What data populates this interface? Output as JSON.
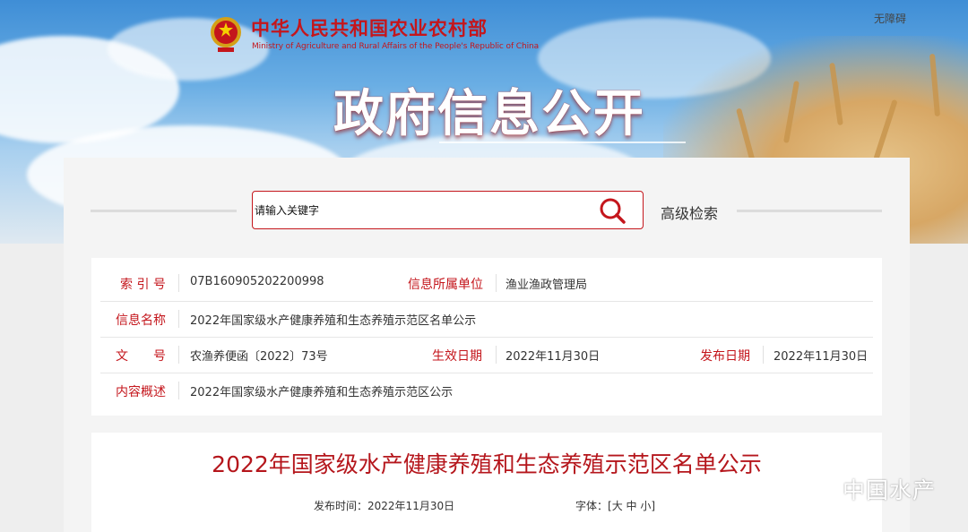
{
  "header": {
    "brand_cn": "中华人民共和国农业农村部",
    "brand_en": "Ministry of Agriculture and Rural Affairs of the People's Republic of China",
    "accessibility_link": "无障碍",
    "banner_title": "政府信息公开"
  },
  "search": {
    "placeholder": "请输入关键字",
    "advanced_label": "高级检索"
  },
  "info": {
    "index_label": "索 引 号",
    "index_value": "07B160905202200998",
    "unit_label": "信息所属单位",
    "unit_value": "渔业渔政管理局",
    "name_label": "信息名称",
    "name_value": "2022年国家级水产健康养殖和生态养殖示范区名单公示",
    "doc_label": "文　　号",
    "doc_value": "农渔养便函〔2022〕73号",
    "effective_label": "生效日期",
    "effective_value": "2022年11月30日",
    "publish_label": "发布日期",
    "publish_value": "2022年11月30日",
    "summary_label": "内容概述",
    "summary_value": "2022年国家级水产健康养殖和生态养殖示范区公示"
  },
  "article": {
    "title": "2022年国家级水产健康养殖和生态养殖示范区名单公示",
    "publish_time_label": "发布时间：",
    "publish_time_value": "2022年11月30日",
    "font_label": "字体：[",
    "font_large": "大",
    "font_medium": "中",
    "font_small": "小",
    "font_end": "]"
  },
  "watermark": "中国水产",
  "colors": {
    "accent": "#c4161c",
    "title": "#b5161c"
  }
}
